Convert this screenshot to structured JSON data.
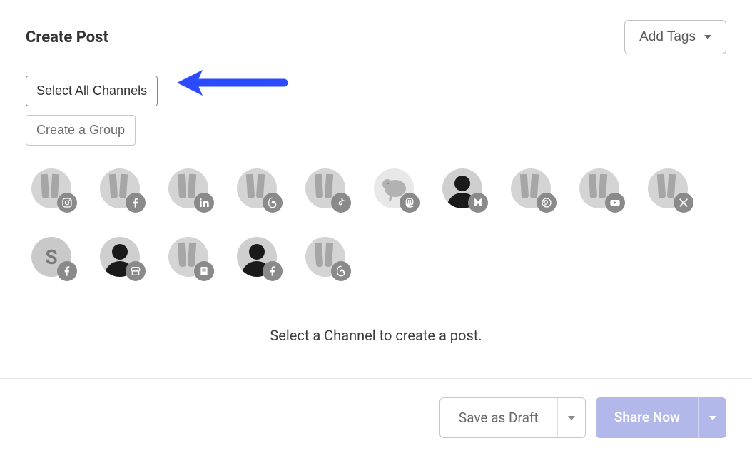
{
  "header": {
    "title": "Create Post",
    "add_tags_label": "Add Tags"
  },
  "controls": {
    "select_all_label": "Select All Channels",
    "create_group_label": "Create a Group"
  },
  "channels": [
    {
      "avatar": "shoes",
      "network": "instagram"
    },
    {
      "avatar": "shoes",
      "network": "facebook"
    },
    {
      "avatar": "shoes",
      "network": "linkedin"
    },
    {
      "avatar": "shoes",
      "network": "threads"
    },
    {
      "avatar": "shoes",
      "network": "tiktok"
    },
    {
      "avatar": "elephant",
      "network": "mastodon"
    },
    {
      "avatar": "person",
      "network": "bluesky"
    },
    {
      "avatar": "shoes",
      "network": "pinterest"
    },
    {
      "avatar": "shoes",
      "network": "youtube"
    },
    {
      "avatar": "shoes",
      "network": "x"
    },
    {
      "avatar": "letter",
      "letter": "S",
      "network": "facebook"
    },
    {
      "avatar": "person",
      "network": "google-business"
    },
    {
      "avatar": "shoes",
      "network": "startpage"
    },
    {
      "avatar": "person",
      "network": "facebook"
    },
    {
      "avatar": "shoes",
      "network": "threads"
    }
  ],
  "prompt_text": "Select a Channel to create a post.",
  "footer": {
    "draft_label": "Save as Draft",
    "share_label": "Share Now"
  },
  "colors": {
    "arrow": "#2c4bff",
    "share_btn_bg": "#b3b8ea"
  }
}
